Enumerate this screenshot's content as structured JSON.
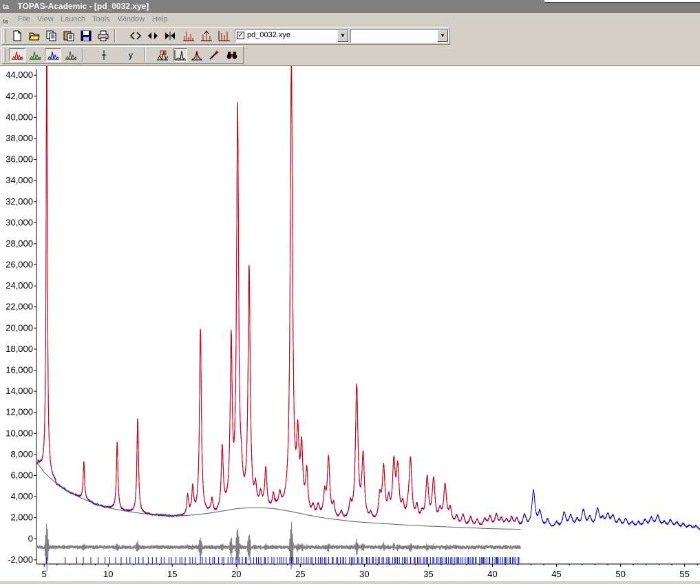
{
  "window": {
    "title": "TOPAS-Academic - [pd_0032.xye]",
    "icon": "ta"
  },
  "menu": {
    "items": [
      "File",
      "View",
      "Launch",
      "Tools",
      "Window",
      "Help"
    ]
  },
  "toolbar1": {
    "icons": [
      "new-file-icon",
      "open-folder-icon",
      "copy-icon",
      "paste-icon",
      "save-icon",
      "print-icon",
      "zoom-out-horizontal-icon",
      "zoom-in-horizontal-icon",
      "fit-horizontal-icon",
      "peaks-scale-icon",
      "peaks-up-icon",
      "peaks-bars-icon"
    ],
    "file_combo_value": "pd_0032.xye",
    "file_combo_checked": true,
    "second_combo_value": ""
  },
  "toolbar2": {
    "icons": [
      "red-pattern-icon",
      "green-pattern-icon",
      "blue-pattern-icon",
      "black-pattern-icon",
      "x-cursor-icon",
      "y-label-icon",
      "fit-pattern-icon",
      "peak-icon",
      "peak-shape-icon",
      "wand-icon",
      "binoculars-icon"
    ],
    "y_label": "y"
  },
  "chart_data": {
    "type": "line",
    "title": "",
    "xlabel": "",
    "ylabel": "",
    "xlim": [
      4.4,
      56.2
    ],
    "ylim": [
      -2400,
      44600
    ],
    "x_ticks": [
      5,
      10,
      15,
      20,
      25,
      30,
      35,
      40,
      45,
      50,
      55
    ],
    "y_ticks": [
      -2000,
      0,
      2000,
      4000,
      6000,
      8000,
      10000,
      12000,
      14000,
      16000,
      18000,
      20000,
      22000,
      24000,
      26000,
      28000,
      30000,
      32000,
      34000,
      36000,
      38000,
      40000,
      42000,
      44000
    ],
    "y_tick_labels": [
      "-2,000",
      "0",
      "2,000",
      "4,000",
      "6,000",
      "8,000",
      "10,000",
      "12,000",
      "14,000",
      "16,000",
      "18,000",
      "20,000",
      "22,000",
      "24,000",
      "26,000",
      "28,000",
      "30,000",
      "32,000",
      "34,000",
      "36,000",
      "38,000",
      "40,000",
      "42,000",
      "44,000"
    ],
    "series": [
      {
        "color": "#0000c0",
        "style": "observed",
        "x_range": [
          4.4,
          56.2
        ]
      },
      {
        "color": "#e00000",
        "style": "calculated",
        "x_range": [
          4.4,
          42.2
        ]
      },
      {
        "color": "#606060",
        "style": "background",
        "x_range": [
          4.4,
          42.2
        ]
      },
      {
        "color": "#808080",
        "style": "difference",
        "offset": -800,
        "x_range": [
          4.4,
          42.2
        ]
      }
    ],
    "background": {
      "x": [
        4.4,
        5.0,
        6.0,
        7.0,
        8.0,
        9.0,
        10.0,
        11.0,
        12.0,
        13.0,
        14.0,
        15.0,
        16.0,
        17.0,
        18.0,
        19.0,
        20.0,
        21.0,
        22.0,
        23.0,
        24.0,
        25.0,
        26.0,
        27.0,
        28.0,
        29.0,
        30.0,
        32.0,
        34.0,
        36.0,
        38.0,
        40.0,
        42.0,
        45.0,
        50.0,
        56.2
      ],
      "y": [
        7300,
        6300,
        5200,
        4400,
        3800,
        3300,
        2950,
        2700,
        2500,
        2350,
        2250,
        2180,
        2200,
        2300,
        2450,
        2650,
        2850,
        2950,
        2950,
        2850,
        2650,
        2400,
        2150,
        1950,
        1800,
        1650,
        1550,
        1400,
        1250,
        1150,
        1050,
        950,
        900,
        850,
        800,
        750
      ]
    },
    "peaks": {
      "positions": [
        5.2,
        8.1,
        10.7,
        12.3,
        16.2,
        16.6,
        17.2,
        18.1,
        18.9,
        19.6,
        20.1,
        20.4,
        21.0,
        21.5,
        21.9,
        22.3,
        22.9,
        23.4,
        24.3,
        24.8,
        25.1,
        25.5,
        26.0,
        26.4,
        26.9,
        27.2,
        27.6,
        28.2,
        28.9,
        29.4,
        29.9,
        30.5,
        31.2,
        31.5,
        31.9,
        32.3,
        32.6,
        33.0,
        33.4,
        33.6,
        34.1,
        34.5,
        34.9,
        35.4,
        35.9,
        36.3,
        36.7,
        37.2,
        37.7,
        38.3,
        38.8,
        39.4,
        39.8,
        40.3,
        40.7,
        41.1,
        41.5,
        41.9,
        42.5,
        43.2,
        43.7,
        44.3,
        45.0,
        45.6,
        46.1,
        46.6,
        47.1,
        47.6,
        48.2,
        48.6,
        49.0,
        49.4,
        49.9,
        50.4,
        50.9,
        51.4,
        51.9,
        52.4,
        52.9,
        53.4,
        53.9,
        54.4,
        54.9,
        55.4,
        55.9
      ],
      "heights": [
        41500,
        3600,
        6400,
        8900,
        1800,
        2500,
        17500,
        1200,
        6000,
        15500,
        37600,
        2000,
        22500,
        1800,
        1200,
        3800,
        1400,
        1200,
        42500,
        6300,
        5500,
        3800,
        800,
        1000,
        2200,
        5600,
        1200,
        600,
        1400,
        12700,
        6000,
        600,
        2200,
        5000,
        1800,
        5300,
        4800,
        1500,
        800,
        5900,
        1500,
        900,
        4300,
        4200,
        1200,
        3700,
        1500,
        900,
        1100,
        900,
        700,
        800,
        1000,
        1200,
        800,
        700,
        900,
        800,
        1200,
        3500,
        1500,
        800,
        600,
        1500,
        1200,
        800,
        1700,
        1000,
        1800,
        800,
        1200,
        1100,
        800,
        900,
        600,
        600,
        800,
        1000,
        1200,
        600,
        800,
        600,
        500,
        400,
        400
      ]
    },
    "tick_marks_count": 180
  }
}
